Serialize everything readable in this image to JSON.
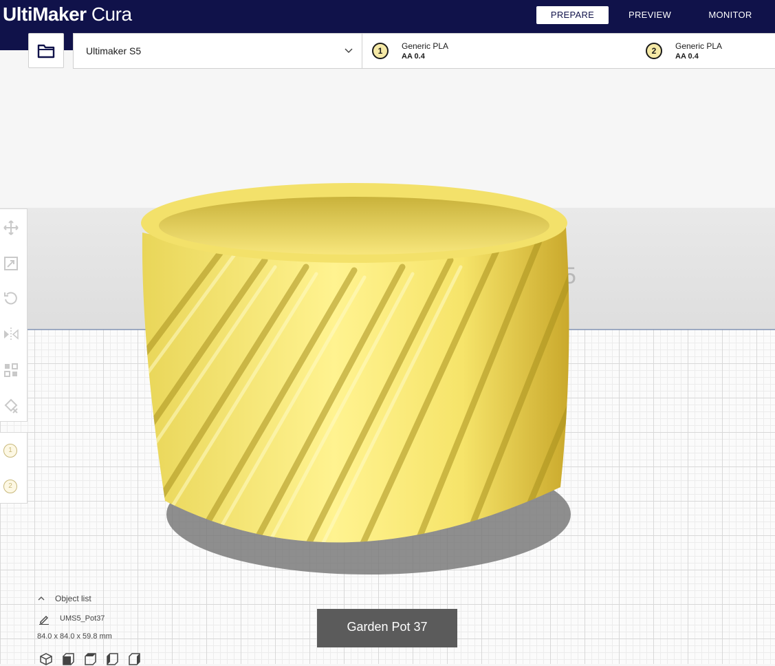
{
  "app": {
    "brand_bold": "UltiMaker",
    "brand_light": "Cura"
  },
  "stages": [
    {
      "label": "PREPARE",
      "active": true
    },
    {
      "label": "PREVIEW",
      "active": false
    },
    {
      "label": "MONITOR",
      "active": false
    }
  ],
  "toolbar": {
    "open_icon": "folder-icon",
    "machine_name": "Ultimaker S5",
    "extruders": [
      {
        "number": "1",
        "material": "Generic PLA",
        "core": "AA 0.4"
      },
      {
        "number": "2",
        "material": "Generic PLA",
        "core": "AA 0.4"
      }
    ]
  },
  "viewport": {
    "model_color": "#f8e86a",
    "background_mark": "5"
  },
  "tools": [
    {
      "name": "move-icon"
    },
    {
      "name": "scale-icon"
    },
    {
      "name": "rotate-icon"
    },
    {
      "name": "mirror-icon"
    },
    {
      "name": "per-model-settings-icon"
    },
    {
      "name": "support-blocker-icon"
    }
  ],
  "extruder_panel": [
    "1",
    "2"
  ],
  "object_list": {
    "header": "Object list",
    "item": "UMS5_Pot37",
    "dimensions": "84.0 x 84.0 x 59.8 mm"
  },
  "view_buttons": [
    {
      "name": "view-3d-icon"
    },
    {
      "name": "view-front-icon"
    },
    {
      "name": "view-top-icon"
    },
    {
      "name": "view-left-icon"
    },
    {
      "name": "view-right-icon"
    }
  ],
  "tooltip": "Garden Pot 37"
}
